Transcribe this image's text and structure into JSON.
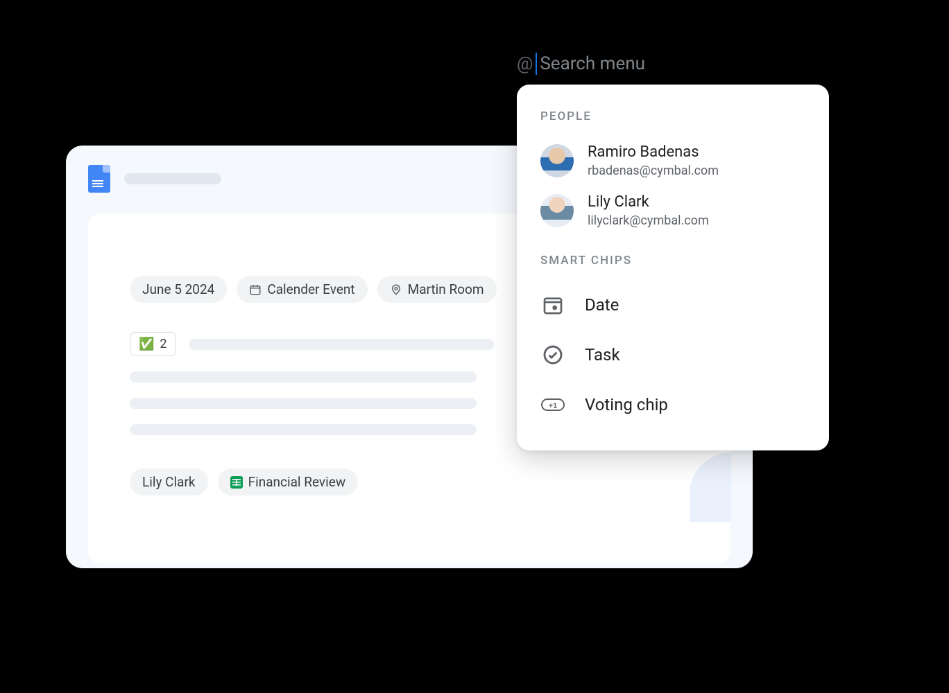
{
  "doc": {
    "chips_top": [
      {
        "label": "June 5 2024",
        "icon": null
      },
      {
        "label": "Calender Event",
        "icon": "calendar"
      },
      {
        "label": "Martin Room",
        "icon": "location"
      }
    ],
    "vote": {
      "emoji": "✅",
      "count": "2"
    },
    "chips_bottom": [
      {
        "label": "Lily Clark",
        "icon": null
      },
      {
        "label": "Financial Review",
        "icon": "sheets"
      }
    ]
  },
  "search": {
    "at": "@",
    "placeholder": "Search menu"
  },
  "menu": {
    "section_people": "PEOPLE",
    "people": [
      {
        "name": "Ramiro Badenas",
        "email": "rbadenas@cymbal.com"
      },
      {
        "name": "Lily Clark",
        "email": "lilyclark@cymbal.com"
      }
    ],
    "section_chips": "SMART CHIPS",
    "options": [
      {
        "label": "Date",
        "icon": "date"
      },
      {
        "label": "Task",
        "icon": "task"
      },
      {
        "label": "Voting chip",
        "icon": "vote"
      }
    ]
  }
}
